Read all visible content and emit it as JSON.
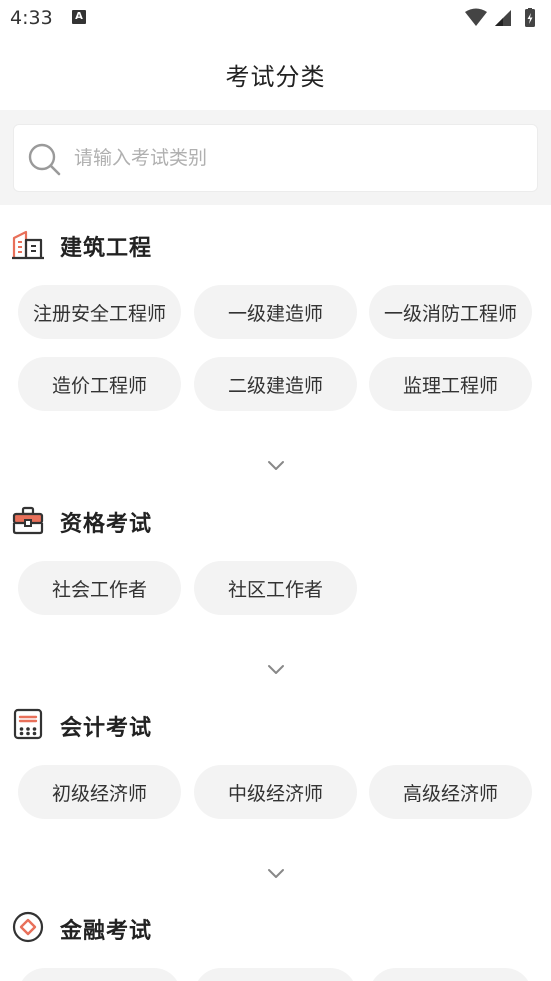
{
  "status_bar": {
    "time": "4:33",
    "notification_letter": "A"
  },
  "header": {
    "title": "考试分类"
  },
  "search": {
    "placeholder": "请输入考试类别",
    "value": ""
  },
  "sections": [
    {
      "title": "建筑工程",
      "icon": "building-icon",
      "accent": "#e8705a",
      "items": [
        "注册安全工程师",
        "一级建造师",
        "一级消防工程师",
        "造价工程师",
        "二级建造师",
        "监理工程师"
      ]
    },
    {
      "title": "资格考试",
      "icon": "briefcase-icon",
      "accent": "#e8705a",
      "items": [
        "社会工作者",
        "社区工作者"
      ]
    },
    {
      "title": "会计考试",
      "icon": "calculator-icon",
      "accent": "#333333",
      "items": [
        "初级经济师",
        "中级经济师",
        "高级经济师"
      ]
    },
    {
      "title": "金融考试",
      "icon": "diamond-icon",
      "accent": "#e8705a",
      "items": []
    }
  ]
}
